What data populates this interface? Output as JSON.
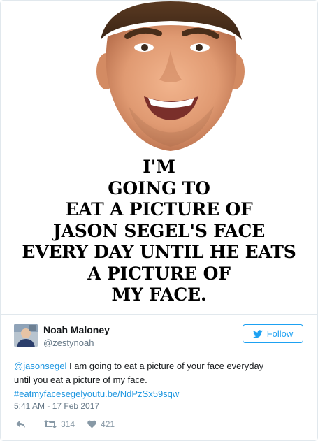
{
  "media": {
    "caption_lines": [
      "I'M",
      "GOING TO",
      "EAT A PICTURE OF",
      "JASON SEGEL'S FACE",
      "EVERY DAY UNTIL HE EATS",
      "A PICTURE OF",
      "MY FACE."
    ]
  },
  "user": {
    "name": "Noah Maloney",
    "handle": "@zestynoah"
  },
  "follow_button": {
    "label": "Follow"
  },
  "tweet": {
    "mention": "@jasonsegel",
    "text_line1_rest": " I am going to eat a picture of your face everyday",
    "text_line2": "until you eat a picture of my face.",
    "link": "#eatmyfacesegelyoutu.be/NdPzSx59sqw",
    "timestamp": "5:41 AM - 17 Feb 2017"
  },
  "actions": {
    "retweets": "314",
    "likes": "421"
  },
  "colors": {
    "accent": "#1da1f2",
    "link": "#1b95e0",
    "muted": "#8899a6"
  },
  "icons": [
    "face-photo",
    "reply-icon",
    "retweet-icon",
    "heart-icon",
    "twitter-bird-icon"
  ]
}
